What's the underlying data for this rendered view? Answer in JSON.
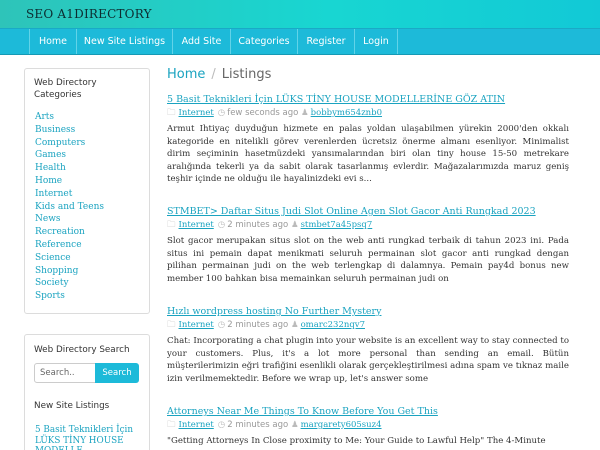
{
  "site": {
    "title": "SEO A1DIRECTORY"
  },
  "nav": {
    "items": [
      "Home",
      "New Site Listings",
      "Add Site",
      "Categories",
      "Register",
      "Login"
    ]
  },
  "sidebar": {
    "categories_heading": "Web Directory Categories",
    "categories": [
      "Arts",
      "Business",
      "Computers",
      "Games",
      "Health",
      "Home",
      "Internet",
      "Kids and Teens",
      "News",
      "Recreation",
      "Reference",
      "Science",
      "Shopping",
      "Society",
      "Sports"
    ],
    "search_heading": "Web Directory Search",
    "search_placeholder": "Search..",
    "search_button": "Search",
    "new_listings_heading": "New Site Listings",
    "new_listings_item": "5 Basit Teknikleri İçin LÜKS TİNY HOUSE MODELLE"
  },
  "breadcrumb": {
    "home": "Home",
    "separator": "/",
    "current": "Listings"
  },
  "listings": [
    {
      "title": "5 Basit Teknikleri İçin LÜKS TİNY HOUSE MODELLERİNE GÖZ ATIN",
      "category": "Internet",
      "time": "few seconds ago",
      "user": "bobbym654znb0",
      "description": "Armut Ihtiyaç duyduğun hizmete en palas yoldan ulaşabilmen yürekin 2000'den okkalı kategoride en nitelikli görev verenlerden ücretsiz önerme almanı esenliyor. Minimalist dirim seçiminin hasetmüzdeki yansımalarından biri olan tiny house 15-50 metrekare aralığında tekerli ya da sabit olarak tasarlanmış evlerdir. Mağazalarımızda maruz geniş teşhir içinde ne olduğu ile hayalinizdeki evi s..."
    },
    {
      "title": "STMBET> Daftar Situs Judi Slot Online Agen Slot Gacor Anti Rungkad 2023",
      "category": "Internet",
      "time": "2 minutes ago",
      "user": "stmbet7a45psq7",
      "description": "Slot gacor merupakan situs slot on the web anti rungkad terbaik di tahun 2023 ini. Pada situs ini pemain dapat menikmati seluruh permainan slot gacor anti rungkad dengan pilihan permainan judi on the web terlengkap di dalamnya. Pemain pay4d bonus new member 100 bahkan bisa memainkan seluruh permainan judi on"
    },
    {
      "title": "Hızlı wordpress hosting No Further Mystery",
      "category": "Internet",
      "time": "2 minutes ago",
      "user": "omarc232nqv7",
      "description": "Chat: Incorporating a chat plugin into your website is an excellent way to stay connected to your customers. Plus, it's a lot more personal than sending an email. Bütün müşterilerimizin eğri trafiğini esenlikli olarak gerçekleştirilmesi adına spam ve tıknaz maile izin verilmemektedir. Before we wrap up, let's answer some"
    },
    {
      "title": "Attorneys Near Me Things To Know Before You Get This",
      "category": "Internet",
      "time": "2 minutes ago",
      "user": "margarety605suz4",
      "description": "\"Getting Attorneys In Close proximity to Me: Your Guide to Lawful Help\" The 4-Minute"
    }
  ]
}
